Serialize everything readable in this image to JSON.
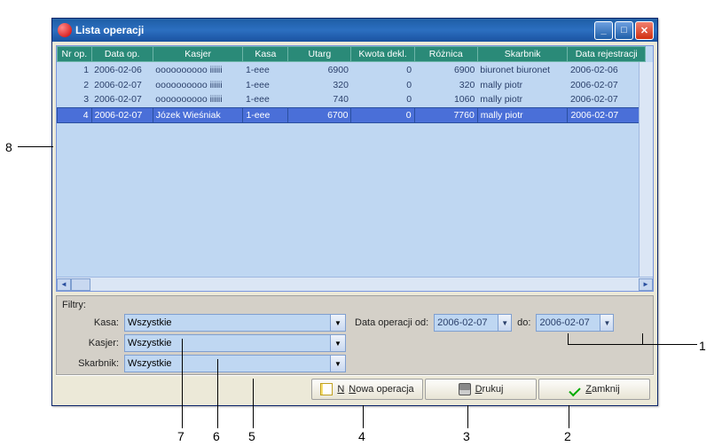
{
  "window": {
    "title": "Lista operacji"
  },
  "columns": [
    "Nr op.",
    "Data op.",
    "Kasjer",
    "Kasa",
    "Utarg",
    "Kwota dekl.",
    "Różnica",
    "Skarbnik",
    "Data rejestracji"
  ],
  "rows": [
    {
      "nr": "1",
      "data_op": "2006-02-06",
      "kasjer": "oooooooooo iiiiii",
      "kasa": "1-eee",
      "utarg": "6900",
      "kwota": "0",
      "roznica": "6900",
      "skarbnik": "biuronet biuronet",
      "data_rej": "2006-02-06",
      "selected": false
    },
    {
      "nr": "2",
      "data_op": "2006-02-07",
      "kasjer": "oooooooooo iiiiii",
      "kasa": "1-eee",
      "utarg": "320",
      "kwota": "0",
      "roznica": "320",
      "skarbnik": "mally piotr",
      "data_rej": "2006-02-07",
      "selected": false
    },
    {
      "nr": "3",
      "data_op": "2006-02-07",
      "kasjer": "oooooooooo iiiiii",
      "kasa": "1-eee",
      "utarg": "740",
      "kwota": "0",
      "roznica": "1060",
      "skarbnik": "mally piotr",
      "data_rej": "2006-02-07",
      "selected": false
    },
    {
      "nr": "4",
      "data_op": "2006-02-07",
      "kasjer": "Józek Wieśniak",
      "kasa": "1-eee",
      "utarg": "6700",
      "kwota": "0",
      "roznica": "7760",
      "skarbnik": "mally piotr",
      "data_rej": "2006-02-07",
      "selected": true
    }
  ],
  "filters": {
    "title": "Filtry:",
    "kasa_label": "Kasa:",
    "kasa_value": "Wszystkie",
    "kasjer_label": "Kasjer:",
    "kasjer_value": "Wszystkie",
    "skarbnik_label": "Skarbnik:",
    "skarbnik_value": "Wszystkie",
    "date_from_label": "Data operacji od:",
    "date_from_value": "2006-02-07",
    "date_to_label": "do:",
    "date_to_value": "2006-02-07"
  },
  "buttons": {
    "new": "Nowa operacja",
    "print": "Drukuj",
    "close": "Zamknij"
  },
  "callouts": {
    "c1": "1",
    "c2": "2",
    "c3": "3",
    "c4": "4",
    "c5": "5",
    "c6": "6",
    "c7": "7",
    "c8": "8"
  }
}
